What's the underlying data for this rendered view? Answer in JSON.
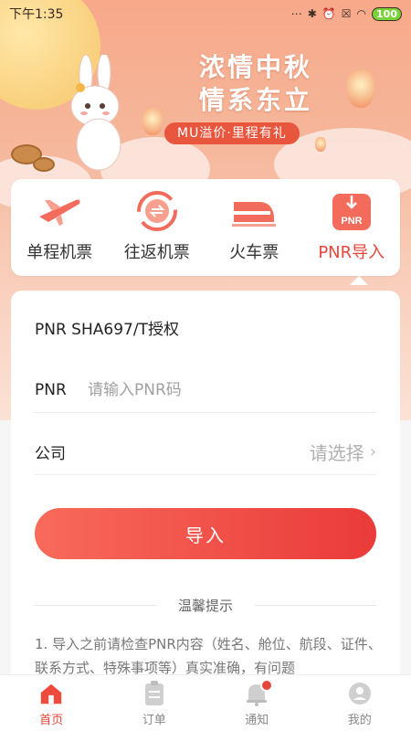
{
  "status": {
    "time": "下午1:35",
    "battery": "100"
  },
  "banner": {
    "title_line1": "浓情中秋",
    "title_line2": "情系东立",
    "slogan": "MU溢价·里程有礼"
  },
  "categories": [
    {
      "label": "单程机票",
      "icon": "plane-icon"
    },
    {
      "label": "往返机票",
      "icon": "round-trip-icon"
    },
    {
      "label": "火车票",
      "icon": "train-icon"
    },
    {
      "label": "PNR导入",
      "icon": "pnr-icon",
      "badge_text": "PNR"
    }
  ],
  "form": {
    "title": "PNR SHA697/T授权",
    "pnr_label": "PNR",
    "pnr_placeholder": "请输入PNR码",
    "company_label": "公司",
    "company_placeholder": "请选择",
    "submit_label": "导入"
  },
  "tips": {
    "title": "温馨提示",
    "text": "1. 导入之前请检查PNR内容（姓名、舱位、航段、证件、联系方式、特殊事项等）真实准确，有问题"
  },
  "tabs": [
    {
      "label": "首页",
      "icon": "home-icon"
    },
    {
      "label": "订单",
      "icon": "orders-icon"
    },
    {
      "label": "通知",
      "icon": "bell-icon"
    },
    {
      "label": "我的",
      "icon": "profile-icon"
    }
  ],
  "colors": {
    "accent": "#e8453a",
    "banner": "#f7a98a"
  }
}
